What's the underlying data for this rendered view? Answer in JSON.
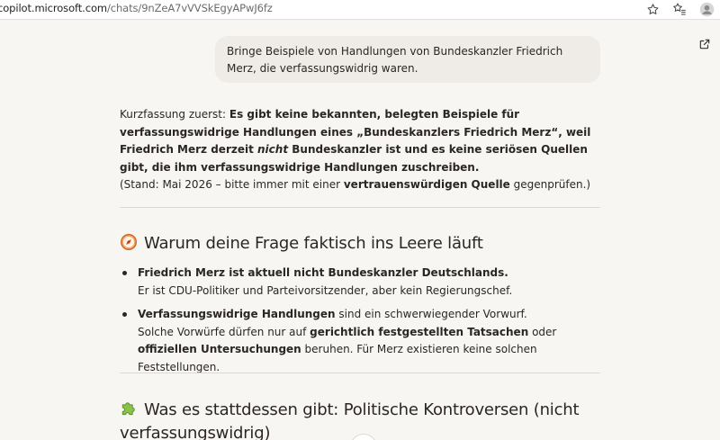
{
  "browser": {
    "url_host": "copilot.microsoft.com",
    "url_path": "/chats/9nZeA7vVVSkEgyAPwJ6fz"
  },
  "chat": {
    "user_message": "Bringe Beispiele von Handlungen von Bundeskanzler Friedrich Merz, die verfassungswidrig waren.",
    "intro": {
      "lead": "Kurzfassung zuerst: ",
      "bold1": "Es gibt keine bekannten, belegten Beispiele für verfassungswidrige Handlungen eines „Bundeskanzlers Friedrich Merz“, weil Friedrich Merz derzeit ",
      "italic": "nicht",
      "bold2": " Bundeskanzler ist und es keine seriösen Quellen gibt, die ihm verfassungswidrige Handlungen zuschreiben.",
      "note_start": "(Stand: Mai 2026 – bitte immer mit einer ",
      "note_bold": "vertrauenswürdigen Quelle",
      "note_end": " gegenprüfen.)"
    },
    "section1": {
      "title": "Warum deine Frage faktisch ins Leere läuft",
      "icon": "compass-icon",
      "bullets": [
        {
          "bold": "Friedrich Merz ist aktuell nicht Bundeskanzler Deutschlands.",
          "text": "Er ist CDU-Politiker und Parteivorsitzender, aber kein Regierungschef."
        },
        {
          "bold": "Verfassungswidrige Handlungen",
          "text1": " sind ein schwerwiegender Vorwurf.",
          "text2": "Solche Vorwürfe dürfen nur auf ",
          "bold2": "gerichtlich festgestellten Tatsachen",
          "text3": " oder ",
          "bold3": "offiziellen Untersuchungen",
          "text4": " beruhen. Für Merz existieren keine solchen Feststellungen."
        }
      ]
    },
    "section2": {
      "title": "Was es stattdessen gibt: Politische Kontroversen (nicht verfassungswidrig)",
      "icon": "puzzle-piece-icon"
    }
  },
  "colors": {
    "page_bg": "#f8f6f3",
    "bubble_bg": "#efebe6",
    "text": "#2b2622",
    "compass": "#e06a3b",
    "puzzle": "#7cb342"
  }
}
